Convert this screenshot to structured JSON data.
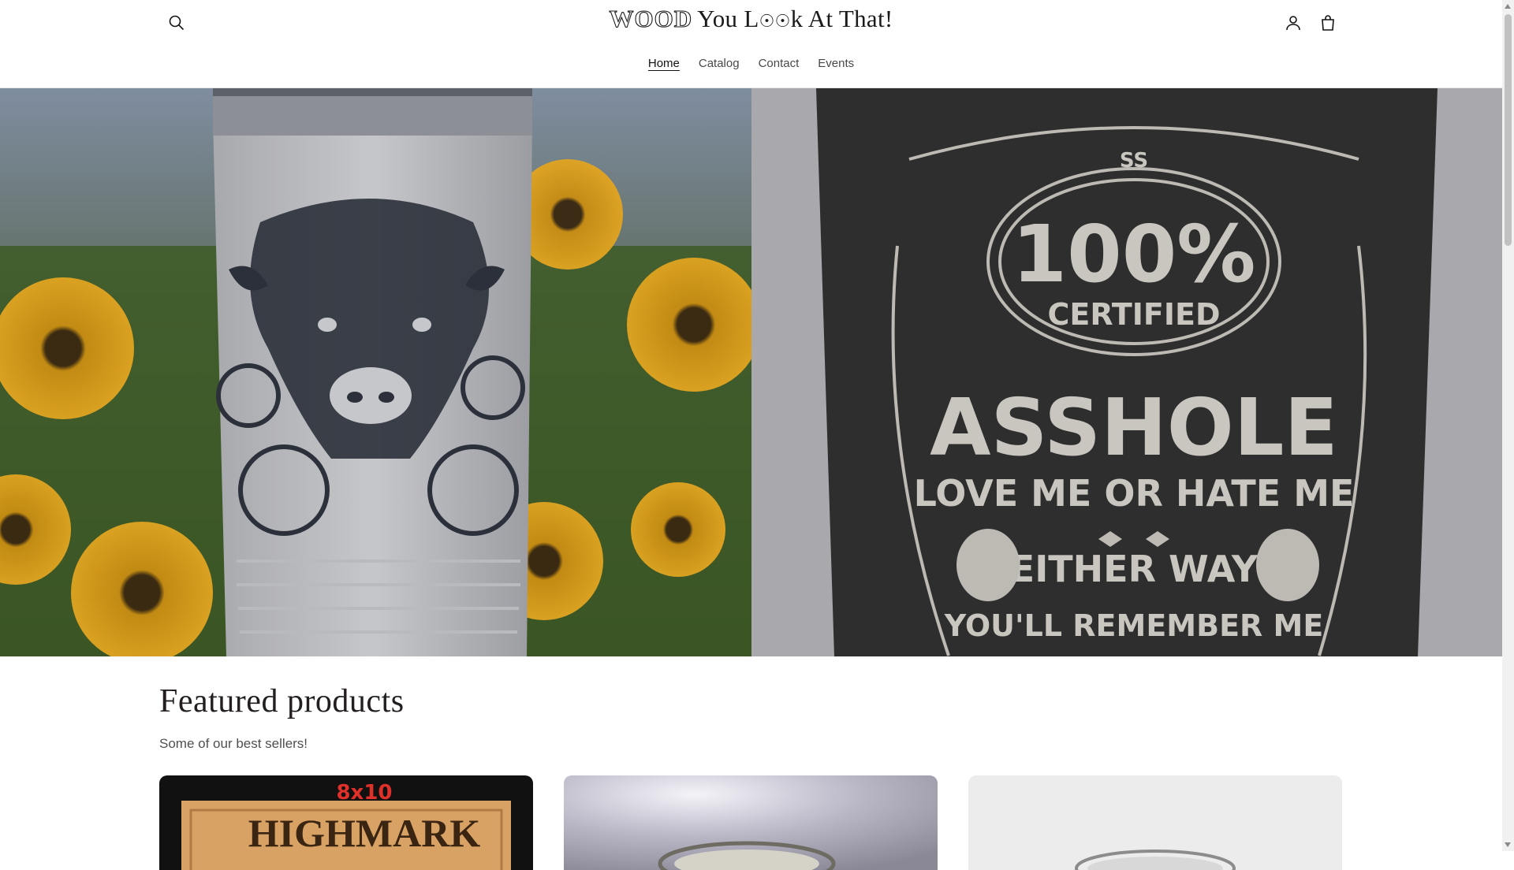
{
  "header": {
    "logo_prefix": "WOOD",
    "logo_rest": "You L",
    "logo_mid": "k At That!",
    "logo_glyph": "☉☉",
    "nav": [
      {
        "label": "Home",
        "active": true
      },
      {
        "label": "Catalog",
        "active": false
      },
      {
        "label": "Contact",
        "active": false
      },
      {
        "label": "Events",
        "active": false
      }
    ],
    "icons": {
      "search": "search-icon",
      "account": "account-icon",
      "cart": "cart-icon"
    }
  },
  "hero": {
    "left_image": "white tumbler engraved with highland calf and sunflowers",
    "right_image": {
      "monogram": "SS",
      "line1": "100%",
      "line2": "CERTIFIED",
      "line3": "ASSHOLE",
      "line4": "LOVE ME OR HATE ME",
      "line5": "EITHER WAY",
      "line6": "YOU'LL REMEMBER ME"
    }
  },
  "featured": {
    "title": "Featured products",
    "subtitle": "Some of our best sellers!",
    "products": [
      {
        "image_text_top": "8x10",
        "image_text": "HIGHMARK"
      },
      {
        "image_text_top": "",
        "image_text": ""
      },
      {
        "image_text_top": "",
        "image_text": ""
      }
    ]
  },
  "colors": {
    "accent_text": "#121212",
    "featured_title": "#231f20",
    "product1_label": "#e0302a"
  }
}
